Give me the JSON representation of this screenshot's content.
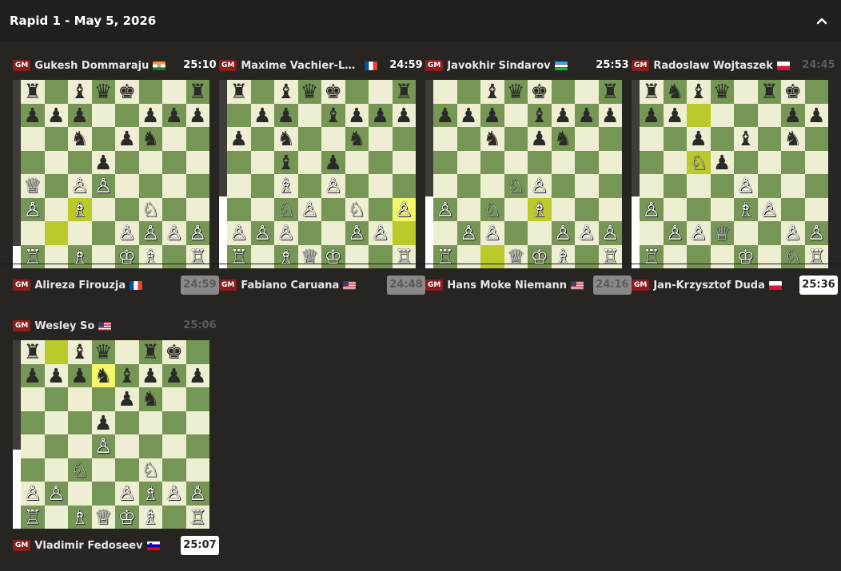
{
  "header": {
    "title": "Rapid 1 - May 5, 2026",
    "collapse_icon": "chevron-up-icon"
  },
  "colors": {
    "light": "#eeeed2",
    "dark": "#769656",
    "highlight_light": "#f6f669",
    "highlight_dark": "#baca2b",
    "gm_badge": "#8b1e1c"
  },
  "games": [
    {
      "top": {
        "title": "GM",
        "name": "Gukesh Dommaraju",
        "flag": "IN",
        "clock": "25:10",
        "clock_state": "tick"
      },
      "bottom": {
        "title": "GM",
        "name": "Alireza Firouzja",
        "flag": "FR",
        "clock": "24:59",
        "clock_state": "inactive"
      },
      "eval_white_fraction": 0.12,
      "ranks": [
        "r.bqk..r",
        "ppp..ppp",
        "..n.pn..",
        "...p....",
        "Q.PP....",
        "P.B..N..",
        "....PPPP",
        "R.B.KB.R"
      ],
      "highlights": [
        "c3",
        "b2"
      ]
    },
    {
      "top": {
        "title": "GM",
        "name": "Maxime Vachier-Lag...",
        "flag": "FR",
        "clock": "24:59",
        "clock_state": "tick"
      },
      "bottom": {
        "title": "GM",
        "name": "Fabiano Caruana",
        "flag": "US",
        "clock": "24:48",
        "clock_state": "inactive"
      },
      "eval_white_fraction": 0.38,
      "ranks": [
        "r.bqk..r",
        ".pp.bppp",
        "p.n..n..",
        "..b.p...",
        "..B.P...",
        "..NP.N.P",
        "PPP..PP.",
        "R.BQK..R"
      ],
      "highlights": [
        "h3",
        "h2"
      ]
    },
    {
      "top": {
        "title": "GM",
        "name": "Javokhir Sindarov",
        "flag": "UZ",
        "clock": "25:53",
        "clock_state": "tick"
      },
      "bottom": {
        "title": "GM",
        "name": "Hans Moke Niemann",
        "flag": "US",
        "clock": "24:16",
        "clock_state": "inactive"
      },
      "eval_white_fraction": 0.38,
      "ranks": [
        "..bqk..r",
        "ppp.bppp",
        "..n.pn..",
        "........",
        "...NP...",
        "P.N.B...",
        ".PP..PPP",
        "R..QKB.R"
      ],
      "highlights": [
        "e3",
        "c1"
      ]
    },
    {
      "top": {
        "title": "GM",
        "name": "Radoslaw Wojtaszek",
        "flag": "PL",
        "clock": "24:45",
        "clock_state": "dim"
      },
      "bottom": {
        "title": "GM",
        "name": "Jan-Krzysztof Duda",
        "flag": "PL",
        "clock": "25:36",
        "clock_state": "active"
      },
      "eval_white_fraction": 0.38,
      "ranks": [
        "rnbq.rk.",
        "pp....pp",
        "..p.b.n.",
        "..Np....",
        "....P...",
        "P...BP..",
        ".PPQ..PP",
        "R...K.NR"
      ],
      "highlights": [
        "c7",
        "c5"
      ]
    },
    {
      "top": {
        "title": "GM",
        "name": "Wesley So",
        "flag": "US",
        "clock": "25:06",
        "clock_state": "dim"
      },
      "bottom": {
        "title": "GM",
        "name": "Vladimir Fedoseev",
        "flag": "SI",
        "clock": "25:07",
        "clock_state": "active"
      },
      "eval_white_fraction": 0.42,
      "ranks": [
        "r.bq.rk.",
        "pppnbppp",
        "....pn..",
        "...p....",
        "...P....",
        "..N..N..",
        "PP..PBPP",
        "R.BQKB.R"
      ],
      "highlights": [
        "b8",
        "d7"
      ]
    }
  ]
}
